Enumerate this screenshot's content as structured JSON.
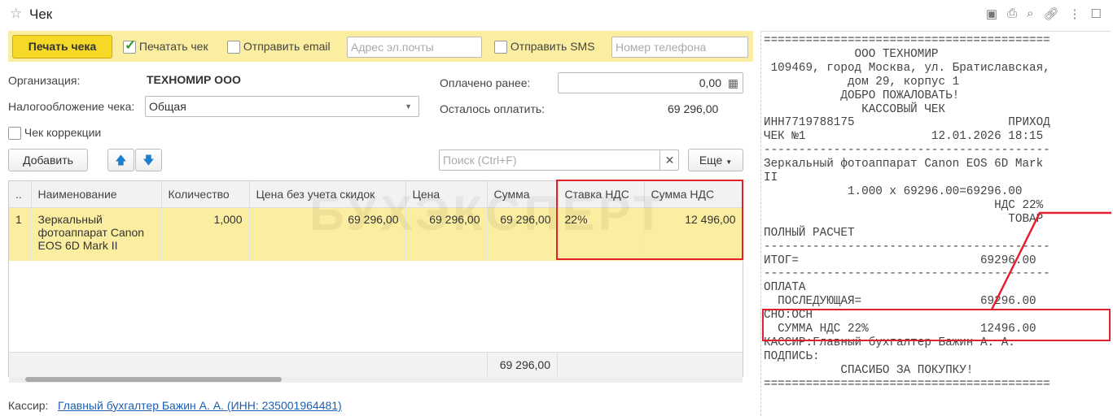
{
  "window": {
    "title": "Чек",
    "icons": [
      "save-icon",
      "print-icon",
      "preview-icon",
      "link-icon",
      "more-icon",
      "maximize-icon"
    ]
  },
  "toolbar": {
    "print_button": "Печать чека",
    "print_check_label": "Печатать чек",
    "print_checked": true,
    "send_email_label": "Отправить email",
    "email_placeholder": "Адрес эл.почты",
    "send_sms_label": "Отправить SMS",
    "phone_placeholder": "Номер телефона"
  },
  "form": {
    "org_label": "Организация:",
    "org_value": "ТЕХНОМИР ООО",
    "tax_label": "Налогообложение чека:",
    "tax_value": "Общая",
    "correction_label": "Чек коррекции",
    "paid_label": "Оплачено ранее:",
    "paid_value": "0,00",
    "remaining_label": "Осталось оплатить:",
    "remaining_value": "69 296,00"
  },
  "list_toolbar": {
    "add": "Добавить",
    "search_placeholder": "Поиск (Ctrl+F)",
    "more": "Еще"
  },
  "table": {
    "headers": [
      "..",
      "Наименование",
      "Количество",
      "Цена без учета скидок",
      "Цена",
      "Сумма",
      "Ставка НДС",
      "Сумма НДС"
    ],
    "rows": [
      [
        "1",
        "Зеркальный фотоаппарат Canon EOS 6D Mark II",
        "1,000",
        "69 296,00",
        "69 296,00",
        "69 296,00",
        "22%",
        "12 496,00"
      ]
    ],
    "footer_total": "69 296,00"
  },
  "cashier": {
    "label": "Кассир:",
    "value": "Главный бухгалтер Бажин А. А. (ИНН: 235001964481)"
  },
  "watermark": "БУХЭКСПЕРТ",
  "receipt": {
    "lines": [
      "=========================================",
      "             ООО ТЕХНОМИР",
      " 109469, город Москва, ул. Братиславская,",
      "            дом 29, корпус 1",
      "           ДОБРО ПОЖАЛОВАТЬ!",
      "              КАССОВЫЙ ЧЕК",
      "ИНН7719788175                      ПРИХОД",
      "ЧЕК №1                  12.01.2026 18:15",
      "-----------------------------------------",
      "Зеркальный фотоаппарат Canon EOS 6D Mark",
      "II",
      "            1.000 x 69296.00=69296.00",
      "                                 НДС 22%",
      "                                   ТОВАР",
      "ПОЛНЫЙ РАСЧЕТ",
      "-----------------------------------------",
      "ИТОГ=                          69296.00",
      "-----------------------------------------",
      "ОПЛАТА",
      "  ПОСЛЕДУЮЩАЯ=                 69296.00",
      "СНО:ОСН",
      "  СУММА НДС 22%                12496.00",
      "КАССИР:Главный бухгалтер Бажин А. А.",
      "ПОДПИСЬ:",
      "           СПАСИБО ЗА ПОКУПКУ!",
      "========================================="
    ]
  }
}
